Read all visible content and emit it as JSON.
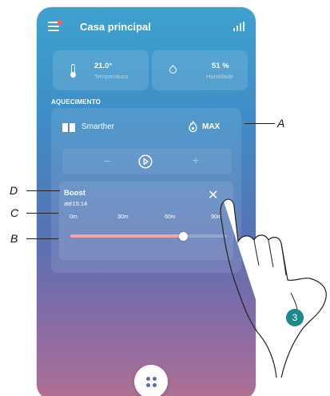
{
  "header": {
    "title": "Casa principal"
  },
  "climate": {
    "temperature": {
      "value": "21.0°",
      "label": "Temperatura"
    },
    "humidity": {
      "value": "51 %",
      "label": "Humidade"
    }
  },
  "heating": {
    "section_title": "AQUECIMENTO",
    "device_name": "Smarther",
    "mode": "MAX",
    "controls": {
      "minus": "−",
      "plus": "+"
    },
    "boost": {
      "title": "Boost",
      "until": "até15:14",
      "close_symbol": "✕",
      "ticks": [
        "0m",
        "30m",
        "60m",
        "90m"
      ],
      "slider_fraction": 0.72
    }
  },
  "callouts": {
    "a": "A",
    "b": "B",
    "c": "C",
    "d": "D"
  },
  "step": "3",
  "colors": {
    "accent_pink": "#f5a3a3",
    "step_badge": "#1a8a8a"
  }
}
